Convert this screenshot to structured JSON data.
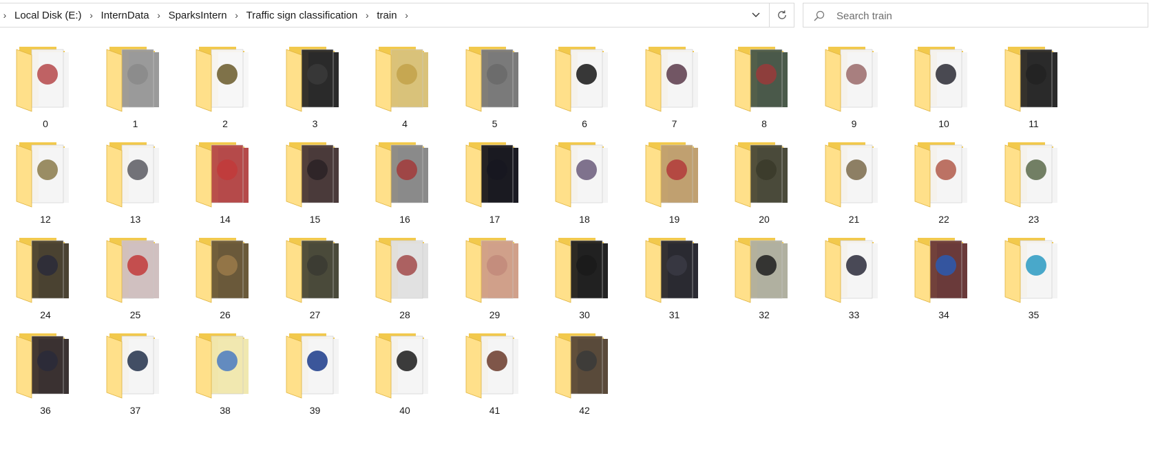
{
  "breadcrumb": {
    "items": [
      "Local Disk (E:)",
      "InternData",
      "SparksIntern",
      "Traffic sign classification",
      "train"
    ]
  },
  "search": {
    "placeholder": "Search train"
  },
  "colors": {
    "folder_back": "#f2c94c",
    "folder_front": "#ffe08a",
    "selection_hover": "#e5f3ff",
    "border": "#d9d9d9"
  },
  "folders": [
    {
      "name": "0",
      "preview": "#b5484a",
      "paper": "#f4f4f4"
    },
    {
      "name": "1",
      "preview": "#8a8a8a",
      "paper": "#9a9a9a"
    },
    {
      "name": "2",
      "preview": "#6a5a2a",
      "paper": "#f7f7f7"
    },
    {
      "name": "3",
      "preview": "#3a3a3a",
      "paper": "#2a2a2a"
    },
    {
      "name": "4",
      "preview": "#c2a24a",
      "paper": "#d9c27a"
    },
    {
      "name": "5",
      "preview": "#6a6a6a",
      "paper": "#7a7a7a"
    },
    {
      "name": "6",
      "preview": "#151515",
      "paper": "#f4f4f4"
    },
    {
      "name": "7",
      "preview": "#5a3a4a",
      "paper": "#f4f4f4"
    },
    {
      "name": "8",
      "preview": "#9a3a3a",
      "paper": "#4a5a4a"
    },
    {
      "name": "9",
      "preview": "#9a6a6a",
      "paper": "#f4f4f4"
    },
    {
      "name": "10",
      "preview": "#2a2a34",
      "paper": "#f4f4f4"
    },
    {
      "name": "11",
      "preview": "#222222",
      "paper": "#2a2a2a"
    },
    {
      "name": "12",
      "preview": "#8a7a4a",
      "paper": "#f4f4f4"
    },
    {
      "name": "13",
      "preview": "#5a5a62",
      "paper": "#f4f4f4"
    },
    {
      "name": "14",
      "preview": "#c23a3a",
      "paper": "#b54a4a"
    },
    {
      "name": "15",
      "preview": "#2a2226",
      "paper": "#4a3a3a"
    },
    {
      "name": "16",
      "preview": "#a23a3a",
      "paper": "#8a8a8a"
    },
    {
      "name": "17",
      "preview": "#181820",
      "paper": "#1a1a22"
    },
    {
      "name": "18",
      "preview": "#6a5a7a",
      "paper": "#f4f4f4"
    },
    {
      "name": "19",
      "preview": "#b23a3a",
      "paper": "#c0a070"
    },
    {
      "name": "20",
      "preview": "#3a3a2a",
      "paper": "#4a4a3a"
    },
    {
      "name": "21",
      "preview": "#7a6a4a",
      "paper": "#f4f4f4"
    },
    {
      "name": "22",
      "preview": "#b25a4a",
      "paper": "#f4f4f4"
    },
    {
      "name": "23",
      "preview": "#5a6a4a",
      "paper": "#f4f4f4"
    },
    {
      "name": "24",
      "preview": "#2a2a3a",
      "paper": "#4a4232"
    },
    {
      "name": "25",
      "preview": "#c23a3a",
      "paper": "#d0c0c0"
    },
    {
      "name": "26",
      "preview": "#9a7a4a",
      "paper": "#6a5a3a"
    },
    {
      "name": "27",
      "preview": "#3a3a32",
      "paper": "#4a4a3a"
    },
    {
      "name": "28",
      "preview": "#a24a4a",
      "paper": "#e0e0e0"
    },
    {
      "name": "29",
      "preview": "#c28a7a",
      "paper": "#d0a08a"
    },
    {
      "name": "30",
      "preview": "#1a1a1a",
      "paper": "#222222"
    },
    {
      "name": "31",
      "preview": "#3a3a44",
      "paper": "#2a2a32"
    },
    {
      "name": "32",
      "preview": "#1e1e1e",
      "paper": "#b0b0a0"
    },
    {
      "name": "33",
      "preview": "#2a2a3a",
      "paper": "#f4f4f4"
    },
    {
      "name": "34",
      "preview": "#2a5ab2",
      "paper": "#6a3a3a"
    },
    {
      "name": "35",
      "preview": "#2a9ac2",
      "paper": "#f4f4f4"
    },
    {
      "name": "36",
      "preview": "#2a2a3a",
      "paper": "#3a3232"
    },
    {
      "name": "37",
      "preview": "#22304a",
      "paper": "#f4f4f4"
    },
    {
      "name": "38",
      "preview": "#4a7ac2",
      "paper": "#f0e8b0"
    },
    {
      "name": "39",
      "preview": "#1a3a8a",
      "paper": "#f4f4f4"
    },
    {
      "name": "40",
      "preview": "#1a1a1a",
      "paper": "#f4f4f4"
    },
    {
      "name": "41",
      "preview": "#6a3a2a",
      "paper": "#f4f4f4"
    },
    {
      "name": "42",
      "preview": "#3a3a3a",
      "paper": "#5a4a3a"
    }
  ]
}
